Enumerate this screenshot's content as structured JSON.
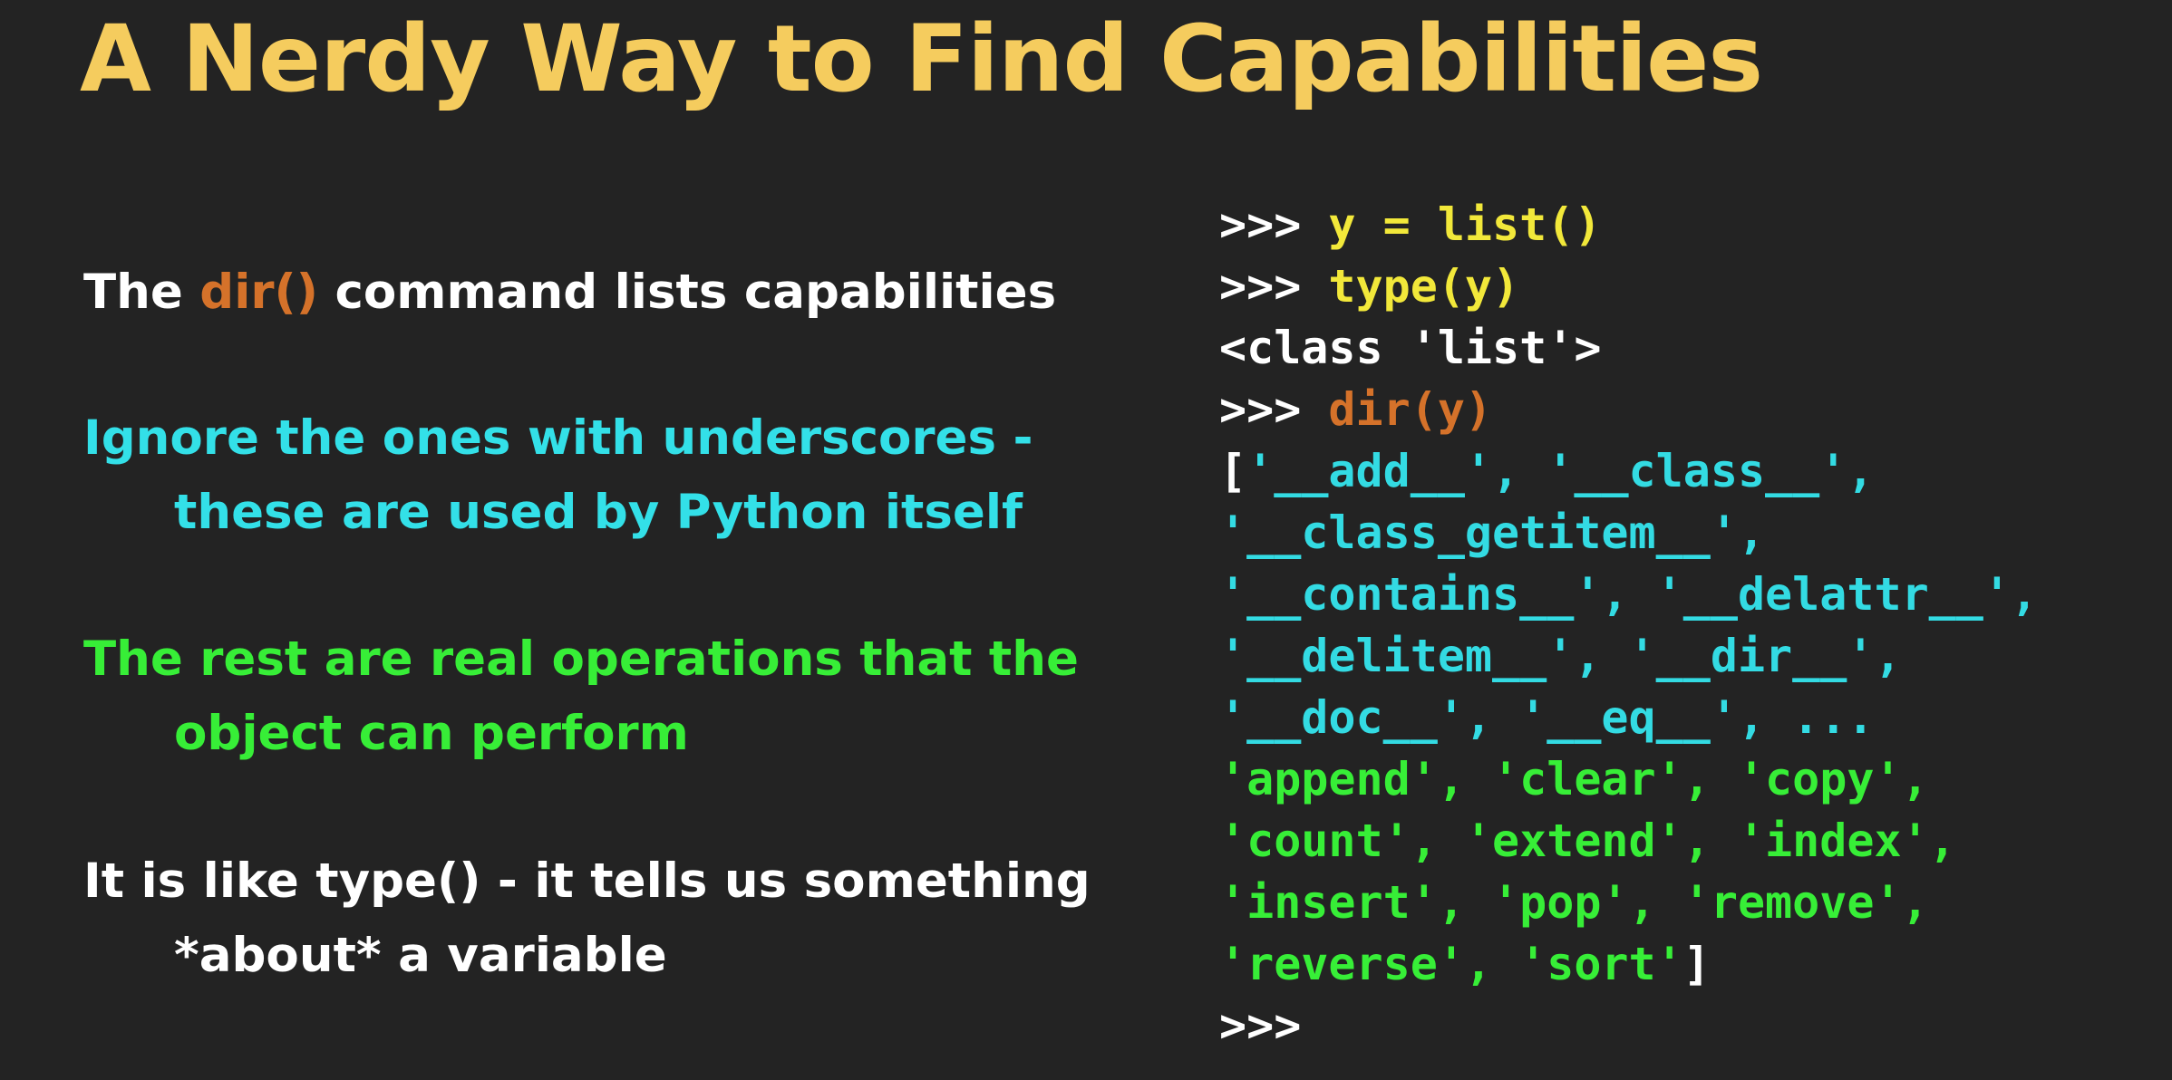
{
  "slide": {
    "title": "A Nerdy Way to Find Capabilities",
    "bullets": {
      "b1": {
        "before": "The ",
        "highlight": "dir()",
        "after": " command lists capabilities"
      },
      "b2": {
        "line1": "Ignore the ones with underscores -",
        "line2": "these are used by Python itself"
      },
      "b3": {
        "line1": "The rest are real operations that the",
        "line2": "object can perform"
      },
      "b4": {
        "line1": "It is like type() - it tells us something",
        "line2": "*about* a variable"
      }
    },
    "code": {
      "prompt": ">>> ",
      "cmd1": "y = list()",
      "cmd2": "type(y)",
      "out1": "<class 'list'>",
      "cmd3": "dir(y)",
      "open_bracket": "[",
      "l1": "'__add__', '__class__',",
      "l2": "'__class_getitem__',",
      "l3": "'__contains__', '__delattr__',",
      "l4": "'__delitem__', '__dir__',",
      "l5": "'__doc__', '__eq__', ...",
      "g1": "'append', 'clear', 'copy',",
      "g2": "'count', 'extend', 'index',",
      "g3": "'insert', 'pop', 'remove',",
      "g4": "'reverse', 'sort'",
      "close_bracket": "]",
      "final_prompt": ">>>"
    }
  },
  "colors": {
    "background": "#232323",
    "title": "#f5cc5e",
    "orange": "#d5722a",
    "cyan": "#33dbe3",
    "green": "#37ee37",
    "yellow": "#f2e83a",
    "white": "#ffffff"
  }
}
